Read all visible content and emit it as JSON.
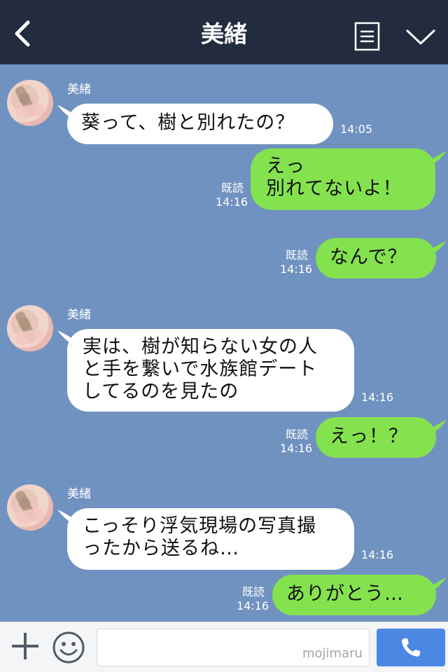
{
  "header": {
    "title": "美緒",
    "back_icon": "chevron-left-icon",
    "menu_icon": "memo-list-icon",
    "expand_icon": "chevron-down-icon",
    "background": "#232b3f"
  },
  "chat": {
    "background": "#7092c0",
    "messages": [
      {
        "side": "in",
        "sender": "美緒",
        "text": "葵って、樹と別れたの？",
        "time": "14:05"
      },
      {
        "side": "out",
        "text": "えっ\n別れてないよ！",
        "read": "既読",
        "time": "14:16"
      },
      {
        "side": "out",
        "text": "なんで？",
        "read": "既読",
        "time": "14:16"
      },
      {
        "side": "in",
        "sender": "美緒",
        "text": "実は、樹が知らない女の人\nと手を繋いで水族館デート\nしてるのを見たの",
        "time": "14:16"
      },
      {
        "side": "out",
        "text": "えっ！？",
        "read": "既読",
        "time": "14:16"
      },
      {
        "side": "in",
        "sender": "美緒",
        "text": "こっそり浮気現場の写真撮\nったから送るね…",
        "time": "14:16"
      },
      {
        "side": "out",
        "text": "ありがとう…",
        "read": "既読",
        "time": "14:16"
      }
    ],
    "incoming_color": "#ffffff",
    "outgoing_color": "#84e24f"
  },
  "footer": {
    "plus_icon": "plus-icon",
    "emoji_icon": "smiley-icon",
    "input_value": "",
    "watermark": "mojimaru",
    "call_icon": "phone-icon",
    "call_color": "#4c87e4"
  }
}
